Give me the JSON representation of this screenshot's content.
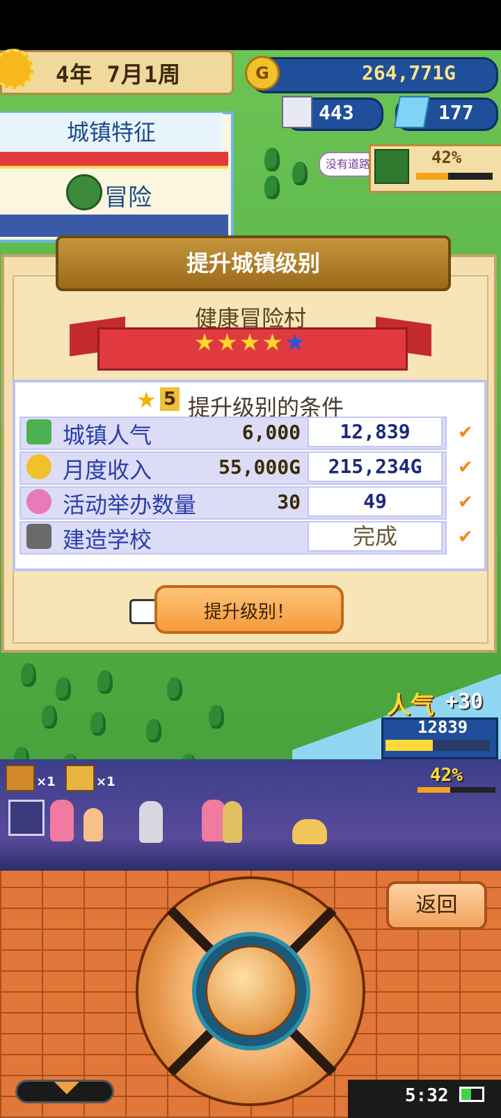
{
  "hud": {
    "date": "4年 7月1周",
    "money": "264,771G",
    "coin_glyph": "G",
    "population": "443",
    "gems": "177",
    "bubble_text": "没有道路",
    "cave_percent": "42%",
    "cave_progress": 0.42
  },
  "town_feature": {
    "title": "城镇特征",
    "feature": "冒险"
  },
  "dialog": {
    "header": "提升城镇级别",
    "village_name": "健康冒险村",
    "stars_on": 4,
    "stars_total": 5,
    "conditions_title": "提升级别的条件",
    "target_level": "5",
    "rows": [
      {
        "icon": "trophy-icon",
        "label": "城镇人气",
        "required": "6,000",
        "current": "12,839",
        "met": true
      },
      {
        "icon": "coin-icon",
        "label": "月度收入",
        "required": "55,000G",
        "current": "215,234G",
        "met": true
      },
      {
        "icon": "balloon-icon",
        "label": "活动举办数量",
        "required": "30",
        "current": "49",
        "met": true
      },
      {
        "icon": "hammer-icon",
        "label": "建造学校",
        "required": "",
        "current": "完成",
        "met": true
      }
    ],
    "check_glyph": "✔",
    "level_up_button": "提升级别！"
  },
  "popularity": {
    "label": "人气",
    "change": "+30",
    "value": "12839",
    "progress": 0.45
  },
  "battle": {
    "chest1_count": "×1",
    "chest2_count": "×1",
    "percent": "42%",
    "progress": 0.42
  },
  "controls": {
    "back_button": "返回"
  },
  "status": {
    "time": "5:32"
  },
  "colors": {
    "accent_orange": "#f49a3c",
    "hud_blue": "#1f4f9a",
    "ribbon_red": "#e03a40",
    "star_on": "#ffd52e",
    "star_off": "#2a56d6",
    "check": "#f08a20"
  }
}
